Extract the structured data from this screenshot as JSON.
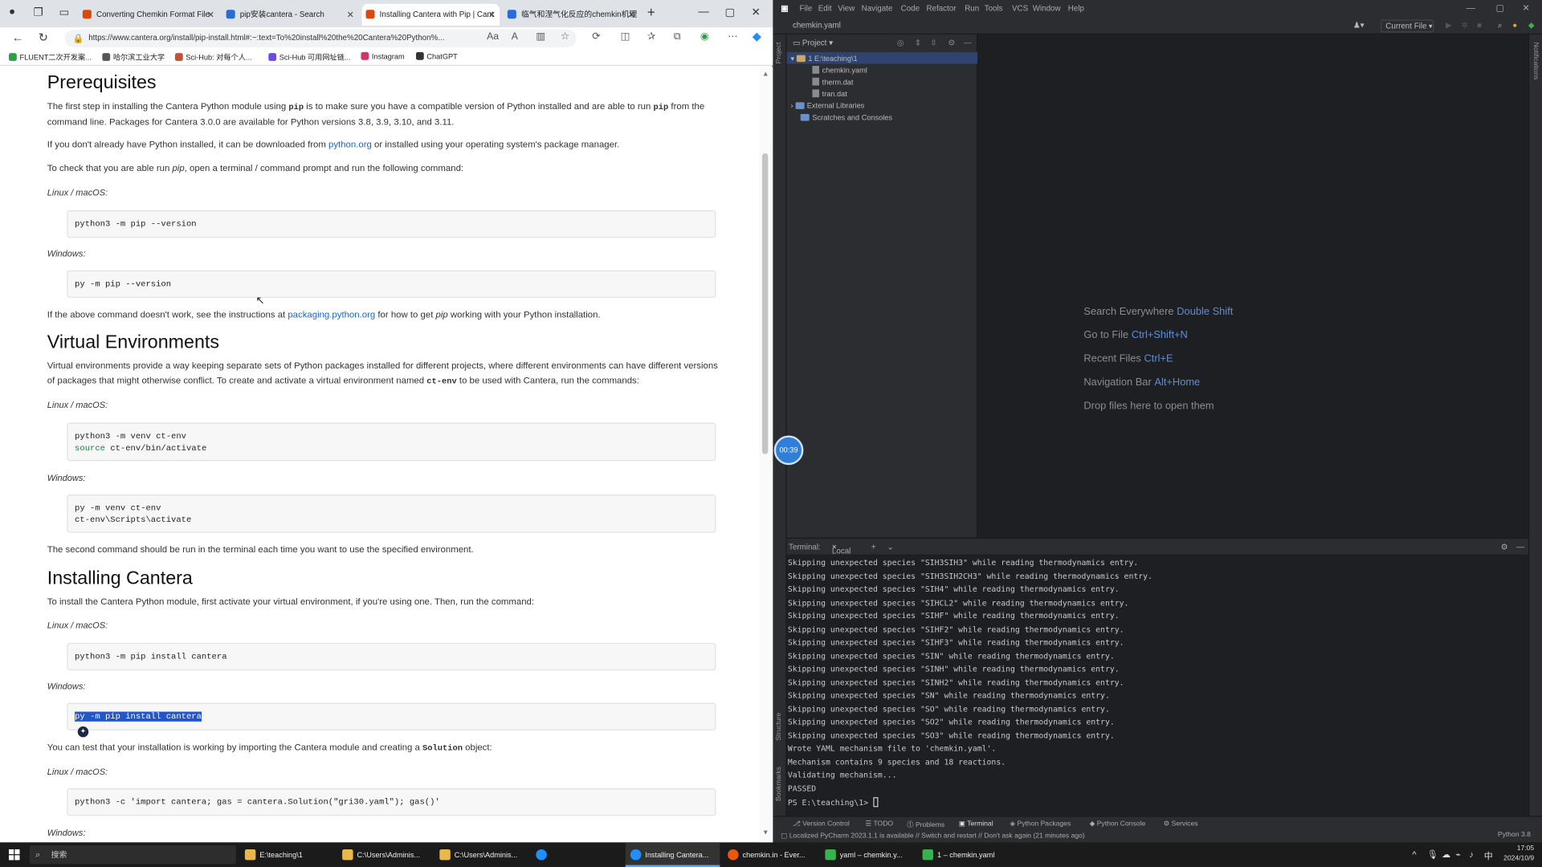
{
  "browser": {
    "tabs": [
      {
        "label": "Converting Chemkin Format File",
        "color": "#d9480f"
      },
      {
        "label": "pip安装cantera - Search",
        "color": "#2b6cd4"
      },
      {
        "label": "Installing Cantera with Pip | Cant",
        "color": "#d9480f"
      },
      {
        "label": "临气和涅气化反应的chemkin机理",
        "color": "#2b6cd4"
      }
    ],
    "url": "https://www.cantera.org/install/pip-install.html#:~:text=To%20install%20the%20Cantera%20Python%...",
    "bookmarks": [
      {
        "label": "FLUENT二次开发案...",
        "color": "#2f9e44"
      },
      {
        "label": "哈尔滨工业大学",
        "color": "#555"
      },
      {
        "label": "Sci-Hub: 对每个人...",
        "color": "#b53"
      },
      {
        "label": "Sci-Hub 可用网址链...",
        "color": "#7048e8"
      },
      {
        "label": "Instagram",
        "color": "#d6336c"
      },
      {
        "label": "ChatGPT",
        "color": "#333"
      }
    ]
  },
  "doc": {
    "h_prereq": "Prerequisites",
    "p1a": "The first step in installing the Cantera Python module using ",
    "p1_code1": "pip",
    "p1b": " is to make sure you have a compatible version of Python installed and are able to run ",
    "p1_code2": "pip",
    "p1c": " from the command line. Packages for Cantera 3.0.0 are available for Python versions 3.8, 3.9, 3.10, and 3.11.",
    "p2a": "If you don't already have Python installed, it can be downloaded from ",
    "p2_link": "python.org",
    "p2b": " or installed using your operating system's package manager.",
    "p3a": "To check that you are able run ",
    "p3_em": "pip",
    "p3b": ", open a terminal / command prompt and run the following command:",
    "lbl_linux": "Linux / macOS:",
    "lbl_windows": "Windows:",
    "c1": "python3 -m pip --version",
    "c2": "py -m pip --version",
    "p4a": "If the above command doesn't work, see the instructions at ",
    "p4_link": "packaging.python.org",
    "p4b": " for how to get ",
    "p4_em": "pip",
    "p4c": " working with your Python installation.",
    "h_venv": "Virtual Environments",
    "p5a": "Virtual environments provide a way keeping separate sets of Python packages installed for different projects, where different environments can have different versions of packages that might otherwise conflict. To create and activate a virtual environment named ",
    "p5_code": "ct-env",
    "p5b": " to be used with Cantera, run the commands:",
    "c3_l1": "python3 -m venv ct-env",
    "c3_kw": "source",
    "c3_l2": " ct-env/bin/activate",
    "c4_l1": "py -m venv ct-env",
    "c4_l2": "ct-env\\Scripts\\activate",
    "p6": "The second command should be run in the terminal each time you want to use the specified environment.",
    "h_install": "Installing Cantera",
    "p7": "To install the Cantera Python module, first activate your virtual environment, if you're using one. Then, run the command:",
    "c5": "python3 -m pip install cantera",
    "c6": "py -m pip install cantera",
    "p8a": "You can test that your installation is working by importing the Cantera module and creating a ",
    "p8_code": "Solution",
    "p8b": " object:",
    "c7": "python3 -c 'import cantera; gas = cantera.Solution(\"gri30.yaml\"); gas()'",
    "lbl_windows_last": "Windows:"
  },
  "ide": {
    "menus": [
      "File",
      "Edit",
      "View",
      "Navigate",
      "Code",
      "Refactor",
      "Run",
      "Tools",
      "VCS",
      "Window",
      "Help"
    ],
    "breadcrumb": "chemkin.yaml",
    "run_config": "Current File",
    "project_label": "Project",
    "tree": {
      "root": "1  E:\\teaching\\1",
      "files": [
        "chemkin.yaml",
        "therm.dat",
        "tran.dat"
      ],
      "external": "External Libraries",
      "scratches": "Scratches and Consoles"
    },
    "hints": [
      {
        "text": "Search Everywhere",
        "key": "Double Shift"
      },
      {
        "text": "Go to File",
        "key": "Ctrl+Shift+N"
      },
      {
        "text": "Recent Files",
        "key": "Ctrl+E"
      },
      {
        "text": "Navigation Bar",
        "key": "Alt+Home"
      },
      {
        "text": "Drop files here to open them",
        "key": ""
      }
    ],
    "timer": "00:39",
    "terminal_tab": "Terminal:",
    "terminal_local": "Local",
    "terminal_lines": [
      "Skipping unexpected species \"SIH3SIH3\" while reading thermodynamics entry.",
      "Skipping unexpected species \"SIH3SIH2CH3\" while reading thermodynamics entry.",
      "Skipping unexpected species \"SIH4\" while reading thermodynamics entry.",
      "Skipping unexpected species \"SIHCL2\" while reading thermodynamics entry.",
      "Skipping unexpected species \"SIHF\" while reading thermodynamics entry.",
      "Skipping unexpected species \"SIHF2\" while reading thermodynamics entry.",
      "Skipping unexpected species \"SIHF3\" while reading thermodynamics entry.",
      "Skipping unexpected species \"SIN\" while reading thermodynamics entry.",
      "Skipping unexpected species \"SINH\" while reading thermodynamics entry.",
      "Skipping unexpected species \"SINH2\" while reading thermodynamics entry.",
      "Skipping unexpected species \"SN\" while reading thermodynamics entry.",
      "Skipping unexpected species \"SO\" while reading thermodynamics entry.",
      "Skipping unexpected species \"SO2\" while reading thermodynamics entry.",
      "Skipping unexpected species \"SO3\" while reading thermodynamics entry.",
      "Wrote YAML mechanism file to 'chemkin.yaml'.",
      "Mechanism contains 9 species and 18 reactions.",
      "Validating mechanism...",
      "PASSED",
      "PS E:\\teaching\\1> "
    ],
    "toolwindows": [
      "Version Control",
      "TODO",
      "Problems",
      "Terminal",
      "Python Packages",
      "Python Console",
      "Services"
    ],
    "status_msg": "Localized PyCharm 2023.1.1 is available // Switch and restart // Don't ask again (21 minutes ago)",
    "interpreter": "Python 3.8"
  },
  "taskbar": {
    "search": "搜索",
    "apps": [
      {
        "label": "E:\\teaching\\1",
        "color": "#e8b84a"
      },
      {
        "label": "C:\\Users\\Adminis...",
        "color": "#e8b84a"
      },
      {
        "label": "C:\\Users\\Adminis...",
        "color": "#e8b84a"
      },
      {
        "label": "",
        "color": "#1e90ff"
      },
      {
        "label": "Installing Cantera...",
        "color": "#1e90ff"
      },
      {
        "label": "chemkin.in - Ever...",
        "color": "#e8590c"
      },
      {
        "label": "yaml – chemkin.y...",
        "color": "#37b24d"
      },
      {
        "label": "1 – chemkin.yaml",
        "color": "#37b24d"
      }
    ],
    "time": "17:05",
    "date": "2024/10/9"
  }
}
